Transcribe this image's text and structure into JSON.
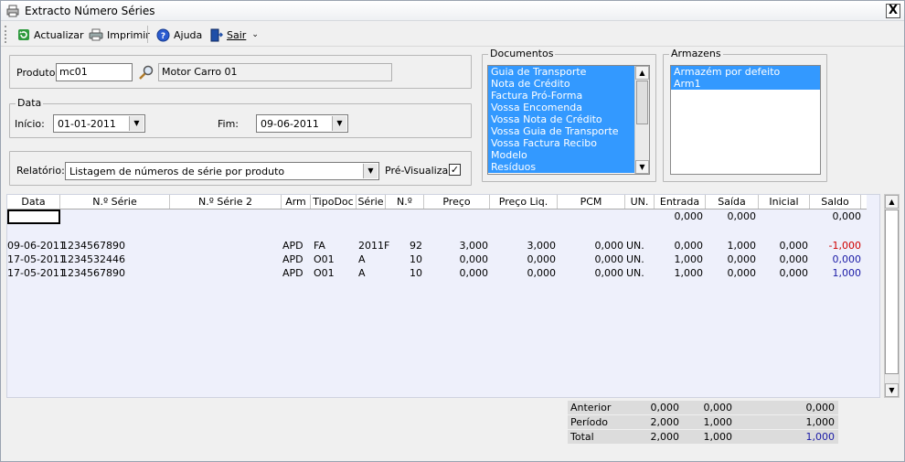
{
  "window": {
    "title": "Extracto Número Séries",
    "close_label": "X"
  },
  "toolbar": {
    "refresh": "Actualizar",
    "print": "Imprimir",
    "help": "Ajuda",
    "exit": "Sair",
    "more": "⌄"
  },
  "produto": {
    "label": "Produto:",
    "code": "mc01",
    "description": "Motor Carro 01"
  },
  "data": {
    "legend": "Data",
    "start_label": "Início:",
    "start": "01-01-2011",
    "end_label": "Fim:",
    "end": "09-06-2011"
  },
  "relatorio": {
    "label": "Relatório:",
    "value": "Listagem de números de série por produto",
    "preview_label": "Pré-Visualizar",
    "preview_checked": "✓"
  },
  "documentos": {
    "legend": "Documentos",
    "items": [
      "Guia de Transporte",
      "Nota de Crédito",
      "Factura Pró-Forma",
      "Vossa Encomenda",
      "Vossa Nota de Crédito",
      "Vossa Guia de Transporte",
      "Vossa Factura Recibo",
      "Modelo",
      "Resíduos"
    ]
  },
  "armazens": {
    "legend": "Armazens",
    "items": [
      "Armazém por defeito",
      "Arm1"
    ]
  },
  "grid": {
    "columns": [
      "Data",
      "N.º Série",
      "N.º Série 2",
      "Arm",
      "TipoDoc",
      "Série",
      "N.º",
      "Preço",
      "Preço Liq.",
      "PCM",
      "UN.",
      "Entrada",
      "Saída",
      "Inicial",
      "Saldo"
    ],
    "opening": {
      "entrada": "0,000",
      "saida": "0,000",
      "saldo": "0,000"
    },
    "rows": [
      {
        "data": "09-06-2011",
        "serie": "1234567890",
        "serie2": "",
        "arm": "APD",
        "tipodoc": "FA",
        "serie_doc": "2011F",
        "num": "92",
        "preco": "3,000",
        "preco_liq": "3,000",
        "pcm": "0,000",
        "un": "UN.",
        "entrada": "0,000",
        "saida": "1,000",
        "inicial": "0,000",
        "saldo": "-1,000",
        "saldo_color": "#d00000"
      },
      {
        "data": "17-05-2011",
        "serie": "1234532446",
        "serie2": "",
        "arm": "APD",
        "tipodoc": "O01",
        "serie_doc": "A",
        "num": "10",
        "preco": "0,000",
        "preco_liq": "0,000",
        "pcm": "0,000",
        "un": "UN.",
        "entrada": "1,000",
        "saida": "0,000",
        "inicial": "0,000",
        "saldo": "0,000",
        "saldo_color": "#1a1aa6"
      },
      {
        "data": "17-05-2011",
        "serie": "1234567890",
        "serie2": "",
        "arm": "APD",
        "tipodoc": "O01",
        "serie_doc": "A",
        "num": "10",
        "preco": "0,000",
        "preco_liq": "0,000",
        "pcm": "0,000",
        "un": "UN.",
        "entrada": "1,000",
        "saida": "0,000",
        "inicial": "0,000",
        "saldo": "1,000",
        "saldo_color": "#1a1aa6"
      }
    ]
  },
  "summary": [
    {
      "label": "Anterior",
      "entrada": "0,000",
      "saida": "0,000",
      "saldo": "0,000"
    },
    {
      "label": "Período",
      "entrada": "2,000",
      "saida": "1,000",
      "saldo": "1,000"
    },
    {
      "label": "Total",
      "entrada": "2,000",
      "saida": "1,000",
      "saldo": "1,000"
    }
  ]
}
